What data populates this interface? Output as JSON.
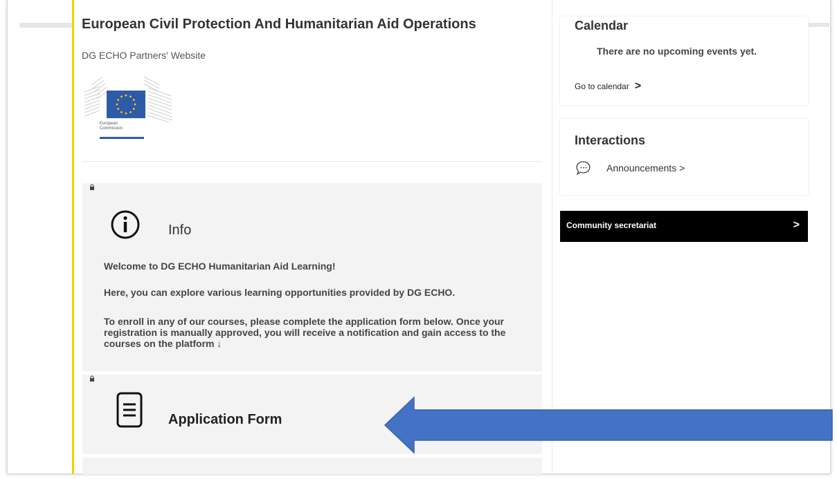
{
  "header": {
    "title": "European Civil Protection And Humanitarian Aid Operations",
    "subtitle": "DG ECHO Partners' Website",
    "logo_text_line1": "European",
    "logo_text_line2": "Commission"
  },
  "info_block": {
    "title": "Info",
    "welcome": "Welcome to DG ECHO Humanitarian Aid Learning!",
    "explore": "Here, you can explore various learning opportunities provided by DG ECHO.",
    "enroll": "To enroll in any of our courses, please complete the application form below. Once your registration is manually approved, you will receive a notification and gain access to the courses on the platform ↓"
  },
  "application_block": {
    "title": "Application Form"
  },
  "calendar": {
    "title": "Calendar",
    "empty_text": "There are no upcoming events yet.",
    "link_label": "Go to calendar",
    "link_chevron": ">"
  },
  "interactions": {
    "title": "Interactions",
    "announcements_label": "Announcements >"
  },
  "secretariat": {
    "label": "Community secretariat",
    "chevron": ">"
  },
  "colors": {
    "accent_yellow": "#f5d300",
    "arrow_blue": "#4472c4",
    "eu_blue": "#2e5ba8",
    "eu_stars": "#ffcc00"
  },
  "icons": [
    "lock-icon",
    "info-icon",
    "document-icon",
    "chat-icon",
    "chevron-right-icon",
    "eu-flag-icon"
  ]
}
